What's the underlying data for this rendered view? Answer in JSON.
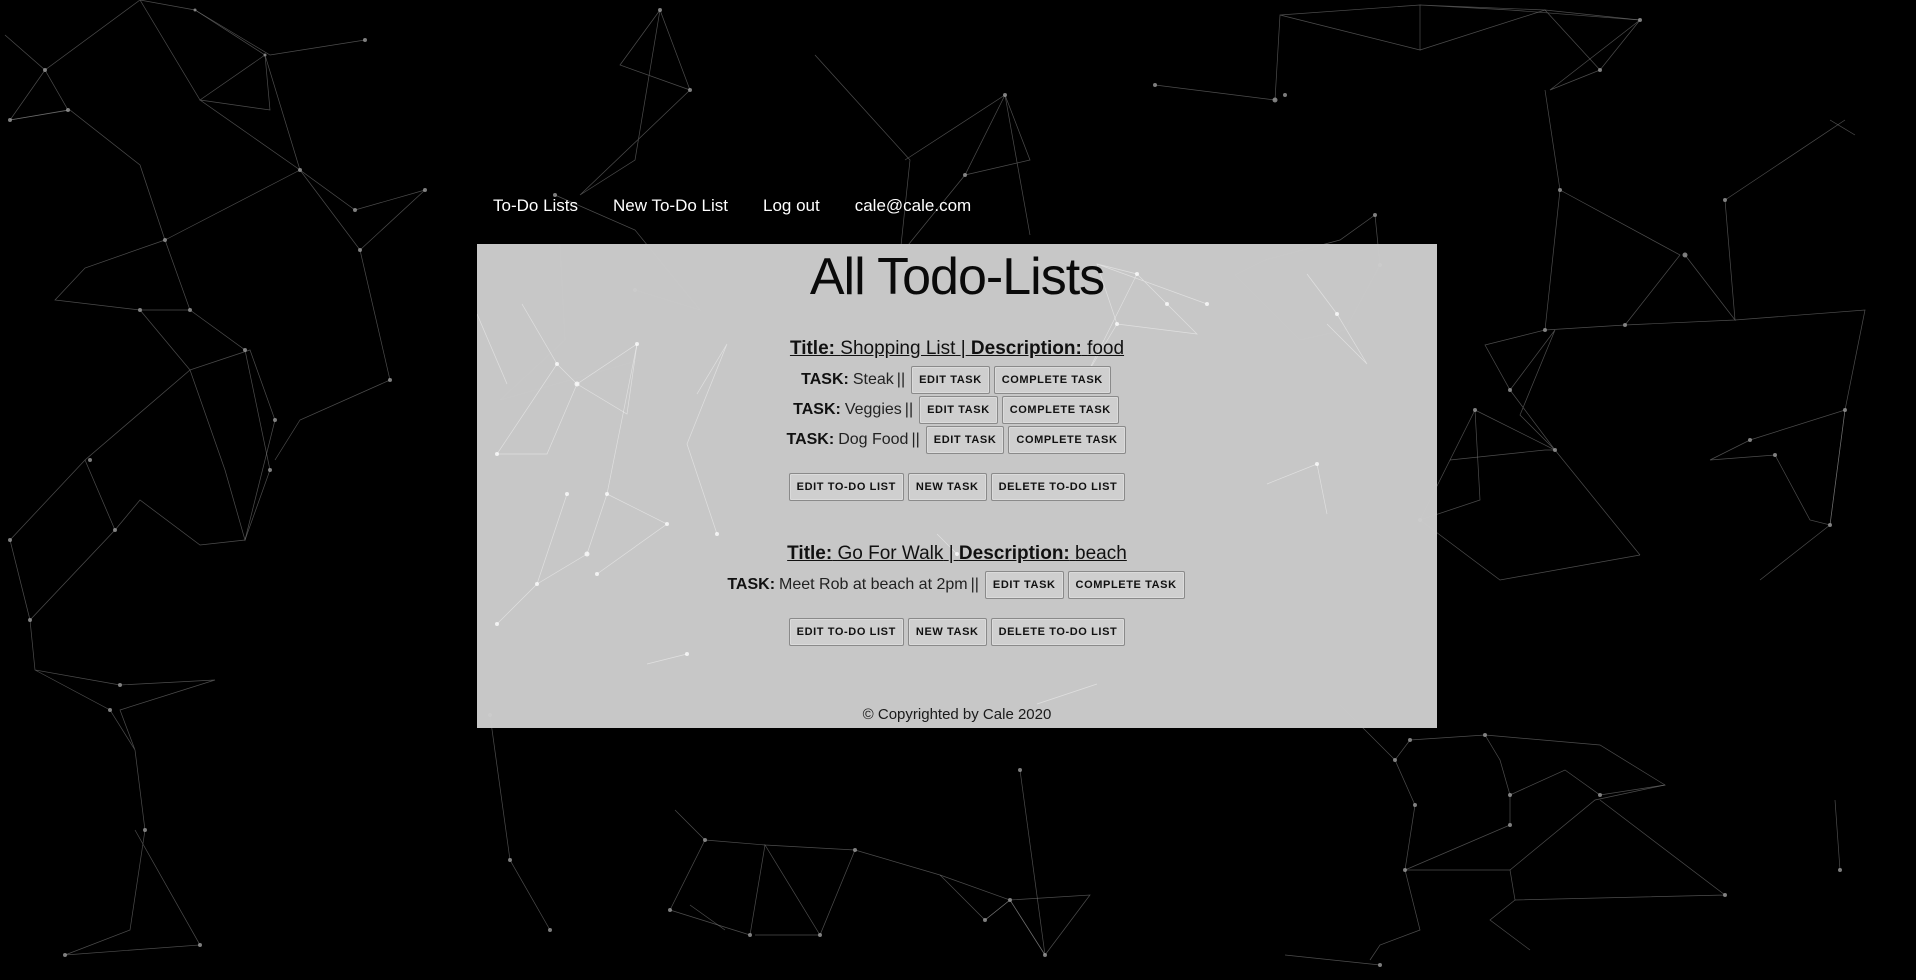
{
  "nav": {
    "items": [
      "To-Do Lists",
      "New To-Do List",
      "Log out"
    ],
    "user_email": "cale@cale.com"
  },
  "page": {
    "title": "All Todo-Lists"
  },
  "labels": {
    "title": "Title:",
    "separator": "|",
    "description": "Description:",
    "task": "TASK:",
    "task_separator": "||"
  },
  "buttons": {
    "edit_task": "EDIT TASK",
    "complete_task": "COMPLETE TASK",
    "edit_list": "EDIT TO-DO LIST",
    "new_task": "NEW TASK",
    "delete_list": "DELETE TO-DO LIST"
  },
  "lists": [
    {
      "title": "Shopping List",
      "description": "food",
      "tasks": [
        "Steak",
        "Veggies",
        "Dog Food"
      ]
    },
    {
      "title": "Go For Walk",
      "description": "beach",
      "tasks": [
        "Meet Rob at beach at 2pm"
      ]
    }
  ],
  "footer": {
    "text": "© Copyrighted by Cale 2020"
  },
  "theme": {
    "background": "#000000",
    "panel": "#cdcdcd",
    "network_lines": "#9a9a9a",
    "text": "#111111"
  }
}
